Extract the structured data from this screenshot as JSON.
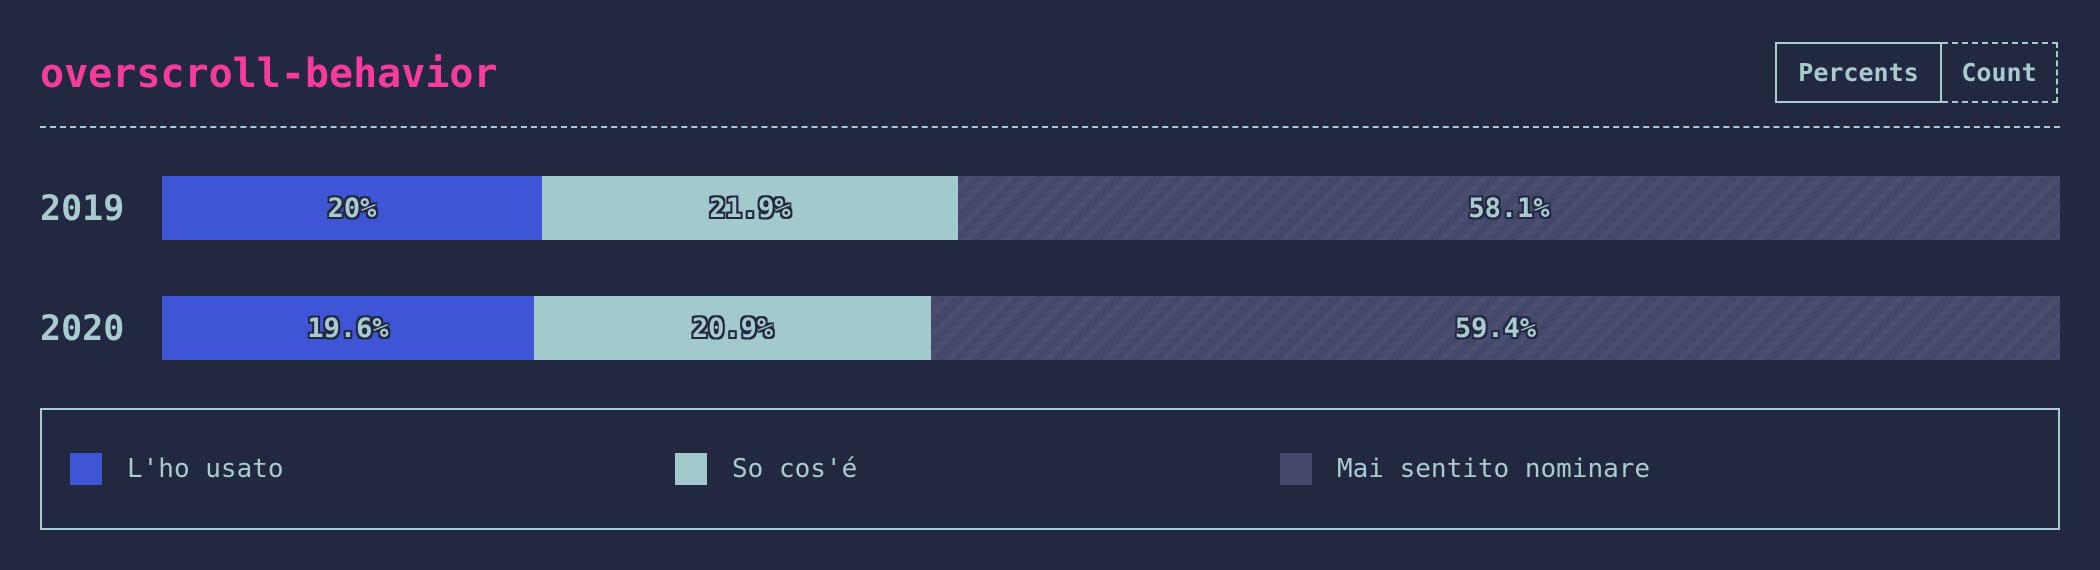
{
  "title": "overscroll-behavior",
  "toggle": {
    "percents_label": "Percents",
    "count_label": "Count",
    "active": "percents"
  },
  "colors": {
    "background": "#232841",
    "title": "#f53c9d",
    "text": "#a8cbcf",
    "used": "#3e56d6",
    "know": "#a2c9cc",
    "never": "#434769"
  },
  "chart_data": {
    "type": "bar",
    "stacked": true,
    "orientation": "horizontal",
    "normalized": true,
    "categories": [
      "2019",
      "2020"
    ],
    "series": [
      {
        "name": "L'ho usato",
        "key": "used",
        "values": [
          20,
          19.6
        ],
        "labels": [
          "20%",
          "19.6%"
        ]
      },
      {
        "name": "So cos'é",
        "key": "know",
        "values": [
          21.9,
          20.9
        ],
        "labels": [
          "21.9%",
          "20.9%"
        ]
      },
      {
        "name": "Mai sentito nominare",
        "key": "never",
        "values": [
          58.1,
          59.4
        ],
        "labels": [
          "58.1%",
          "59.4%"
        ]
      }
    ],
    "xlim": [
      0,
      100
    ],
    "grid": false,
    "legend_position": "bottom"
  }
}
